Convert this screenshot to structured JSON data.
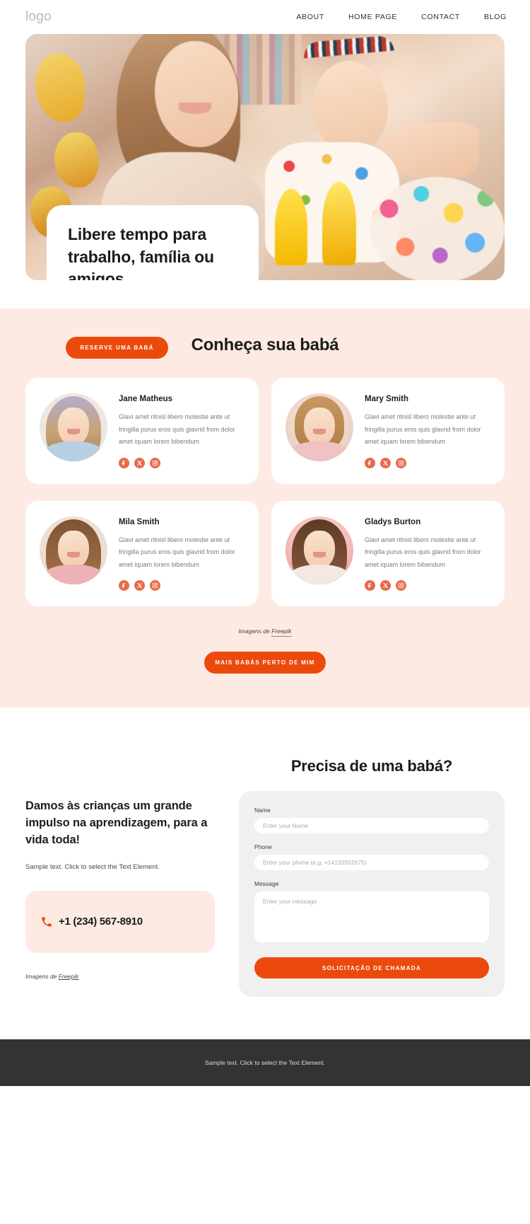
{
  "header": {
    "logo": "logo",
    "nav": [
      {
        "label": "ABOUT"
      },
      {
        "label": "HOME PAGE"
      },
      {
        "label": "CONTACT"
      },
      {
        "label": "BLOG"
      }
    ]
  },
  "hero": {
    "title": "Libere tempo para trabalho, família ou amigos",
    "cta_label": "RESERVE UMA BABÁ",
    "image_alt": "babysitter-playing-with-toddler-photo"
  },
  "sitters": {
    "title": "Conheça sua babá",
    "cards": [
      {
        "name": "Jane Matheus",
        "desc": "Glavi amet ritnisl libero molestie ante ut fringilla purus eros quis glavrid from dolor amet iquam lorem bibendum",
        "avatar_alt": "avatar-jane-matheus"
      },
      {
        "name": "Mary Smith",
        "desc": "Glavi amet ritnisl libero molestie ante ut fringilla purus eros quis glavrid from dolor amet iquam lorem bibendum",
        "avatar_alt": "avatar-mary-smith"
      },
      {
        "name": "Mila Smith",
        "desc": "Glavi amet ritnisl libero molestie ante ut fringilla purus eros quis glavrid from dolor amet iquam lorem bibendum",
        "avatar_alt": "avatar-mila-smith"
      },
      {
        "name": "Gladys Burton",
        "desc": "Glavi amet ritnisl libero molestie ante ut fringilla purus eros quis glavrid from dolor amet iquam lorem bibendum",
        "avatar_alt": "avatar-gladys-burton"
      }
    ],
    "social_icons": [
      "facebook-icon",
      "x-twitter-icon",
      "instagram-icon"
    ],
    "credit_prefix": "Imagens de ",
    "credit_link": "Freepik",
    "cta_label": "MAIS BABÁS PERTO DE MIM"
  },
  "contact": {
    "heading": "Damos às crianças um grande impulso na aprendizagem, para a vida toda!",
    "subtext": "Sample text. Click to select the Text Element.",
    "phone": "+1 (234) 567-8910",
    "phone_icon": "phone-icon",
    "credit_prefix": "Imagens de ",
    "credit_link": "Freepik",
    "form": {
      "title": "Precisa de uma babá?",
      "name_label": "Name",
      "name_placeholder": "Enter your Name",
      "phone_label": "Phone",
      "phone_placeholder": "Enter your phone (e.g. +14155552675)",
      "message_label": "Message",
      "message_placeholder": "Enter your message",
      "submit_label": "SOLICITAÇÃO DE CHAMADA"
    }
  },
  "footer": {
    "text": "Sample text. Click to select the Text Element."
  },
  "colors": {
    "accent": "#ec4a0d",
    "social": "#e8694a",
    "section_bg": "#fdeae2",
    "form_bg": "#f0f0f0",
    "footer_bg": "#333333"
  }
}
